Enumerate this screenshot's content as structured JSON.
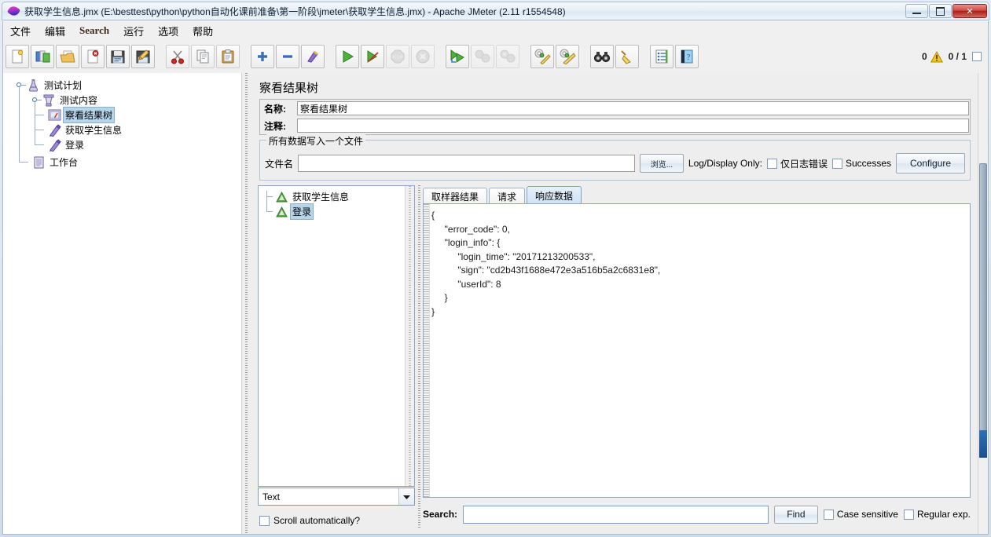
{
  "window": {
    "title": "获取学生信息.jmx (E:\\besttest\\python\\python自动化课前准备\\第一阶段\\jmeter\\获取学生信息.jmx) - Apache JMeter (2.11 r1554548)",
    "icon": "jmeter-feather-icon",
    "controls": {
      "minimize": "minimize-button",
      "maximize": "maximize-button",
      "close": "✕"
    }
  },
  "menu": {
    "items": [
      {
        "label": "文件",
        "latin": false
      },
      {
        "label": "编辑",
        "latin": false
      },
      {
        "label": "Search",
        "latin": true
      },
      {
        "label": "运行",
        "latin": false
      },
      {
        "label": "选项",
        "latin": false
      },
      {
        "label": "帮助",
        "latin": false
      }
    ]
  },
  "toolbar": {
    "buttons": [
      {
        "name": "new-button",
        "icon": "new-document-icon",
        "disabled": false
      },
      {
        "name": "templates-button",
        "icon": "templates-icon",
        "disabled": false
      },
      {
        "name": "open-button",
        "icon": "open-folder-icon",
        "disabled": false
      },
      {
        "name": "close-button",
        "icon": "close-document-icon",
        "disabled": false
      },
      {
        "name": "save-button",
        "icon": "floppy-save-icon",
        "disabled": false
      },
      {
        "name": "save-as-button",
        "icon": "save-as-icon",
        "disabled": false
      },
      {
        "name": "cut-button",
        "icon": "scissors-icon",
        "disabled": false
      },
      {
        "name": "copy-button",
        "icon": "copy-icon",
        "disabled": false
      },
      {
        "name": "paste-button",
        "icon": "clipboard-paste-icon",
        "disabled": false
      },
      {
        "name": "expand-all-button",
        "icon": "plus-icon",
        "disabled": false
      },
      {
        "name": "collapse-all-button",
        "icon": "minus-icon",
        "disabled": false
      },
      {
        "name": "toggle-button",
        "icon": "toggle-pin-icon",
        "disabled": false
      },
      {
        "name": "start-button",
        "icon": "play-green-icon",
        "disabled": false
      },
      {
        "name": "start-no-pauses-button",
        "icon": "play-no-pause-icon",
        "disabled": false
      },
      {
        "name": "stop-button",
        "icon": "stop-sign-icon",
        "disabled": true
      },
      {
        "name": "shutdown-button",
        "icon": "shutdown-x-icon",
        "disabled": true
      },
      {
        "name": "start-remote-all-button",
        "icon": "remote-start-icon",
        "disabled": false
      },
      {
        "name": "stop-remote-all-button",
        "icon": "remote-stop-icon",
        "disabled": true
      },
      {
        "name": "shutdown-remote-all-button",
        "icon": "remote-shutdown-icon",
        "disabled": true
      },
      {
        "name": "clear-button",
        "icon": "gear-broom-icon",
        "disabled": false
      },
      {
        "name": "clear-all-button",
        "icon": "gear-broom-all-icon",
        "disabled": false
      },
      {
        "name": "search-button",
        "icon": "binoculars-icon",
        "disabled": false
      },
      {
        "name": "search-reset-button",
        "icon": "broom-icon",
        "disabled": false
      },
      {
        "name": "function-helper-button",
        "icon": "list-lines-icon",
        "disabled": false
      },
      {
        "name": "help-button",
        "icon": "help-book-icon",
        "disabled": false
      }
    ],
    "warning_count": "0",
    "warning_icon": "warning-triangle-icon",
    "thread_count": "0 / 1"
  },
  "tree": {
    "nodes": [
      {
        "label": "测试计划",
        "icon": "test-plan-flask-icon",
        "depth": 0,
        "selected": false,
        "expandable": true
      },
      {
        "label": "测试内容",
        "icon": "thread-group-icon",
        "depth": 1,
        "selected": false,
        "expandable": true
      },
      {
        "label": "察看结果树",
        "icon": "view-results-tree-icon",
        "depth": 2,
        "selected": true,
        "expandable": false
      },
      {
        "label": "获取学生信息",
        "icon": "http-sampler-pen-icon",
        "depth": 2,
        "selected": false,
        "expandable": false
      },
      {
        "label": "登录",
        "icon": "http-sampler-pen-icon",
        "depth": 2,
        "selected": false,
        "expandable": false
      },
      {
        "label": "工作台",
        "icon": "workbench-icon",
        "depth": 0,
        "selected": false,
        "expandable": false
      }
    ]
  },
  "panel": {
    "title": "察看结果树",
    "name_label": "名称:",
    "name_value": "察看结果树",
    "comment_label": "注释:",
    "comment_value": "",
    "group_legend": "所有数据写入一个文件",
    "filename_label": "文件名",
    "filename_value": "",
    "browse_label": "浏览...",
    "log_display_only_label": "Log/Display Only:",
    "errors_only_label": "仅日志错误",
    "errors_only_checked": false,
    "successes_label": "Successes",
    "successes_checked": false,
    "configure_label": "Configure"
  },
  "results": {
    "items": [
      {
        "label": "获取学生信息",
        "icon": "success-triangle-icon",
        "selected": false
      },
      {
        "label": "登录",
        "icon": "success-triangle-icon",
        "selected": true
      }
    ],
    "renderer_value": "Text",
    "renderer_arrow_icon": "chevron-down-icon",
    "scroll_auto_label": "Scroll automatically?",
    "scroll_auto_checked": false,
    "tabs": [
      {
        "label": "取样器结果",
        "active": false
      },
      {
        "label": "请求",
        "active": false
      },
      {
        "label": "响应数据",
        "active": true
      }
    ],
    "response_text": "{\n     \"error_code\": 0,\n     \"login_info\": {\n          \"login_time\": \"20171213200533\",\n          \"sign\": \"cd2b43f1688e472e3a516b5a2c6831e8\",\n          \"userId\": 8\n     }\n}",
    "search_label": "Search:",
    "search_value": "",
    "find_label": "Find",
    "case_sensitive_label": "Case sensitive",
    "case_sensitive_checked": false,
    "regular_exp_label": "Regular exp.",
    "regular_exp_checked": false
  },
  "colors": {
    "selection": "#b6d4ea",
    "accent": "#2f6fb5",
    "warning": "#f5c518",
    "success": "#3f9f3f",
    "close": "#ab1f16"
  }
}
